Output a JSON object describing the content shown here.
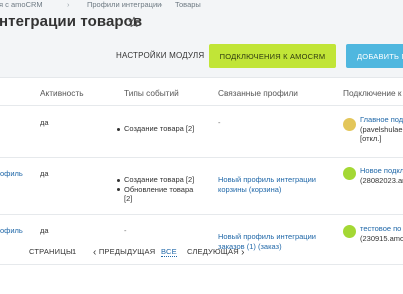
{
  "breadcrumb": {
    "items": [
      "я с amoCRM",
      "Профили интеграции",
      "Товары"
    ],
    "separator": "›"
  },
  "page": {
    "title": "нтеграции товаров",
    "favorite_icon": "star-outline-icon"
  },
  "toolbar": {
    "settings_label": "НАСТРОЙКИ МОДУЛЯ",
    "connections_label": "ПОДКЛЮЧЕНИЯ К AMOCRM",
    "add_label": "ДОБАВИТЬ ПР",
    "connections_color": "#c1e537",
    "add_color": "#4fb7df"
  },
  "table": {
    "headers": [
      "Активность",
      "Типы событий",
      "Связанные профили",
      "Подключение к"
    ],
    "rows": [
      {
        "name": "",
        "active": "да",
        "events": [
          "Создание товара [2]"
        ],
        "profiles": "-",
        "connection_status_color": "#e3c65a",
        "connection": [
          "Главное подк",
          "(pavelshulae",
          "[откл.]"
        ]
      },
      {
        "name": "офиль",
        "active": "да",
        "events": [
          "Создание товара [2]",
          "Обновление товара",
          "[2]"
        ],
        "profiles": [
          "Новый профиль интеграции",
          "корзины (корзина)"
        ],
        "connection_status_color": "#a4d834",
        "connection": [
          "Новое подкл",
          "(28082023.am"
        ]
      },
      {
        "name": "офиль",
        "active": "да",
        "events": "-",
        "profiles": [
          "Новый профиль интеграции",
          "заказов (1) (заказ)"
        ],
        "connection_status_color": "#a4d834",
        "connection": [
          "тестовое по",
          "(230915.amo"
        ]
      }
    ]
  },
  "pagination": {
    "pages_label": "СТРАНИЦЫ:",
    "current_page": "1",
    "prev_label": "ПРЕДЫДУЩАЯ",
    "all_label": "ВСЕ",
    "next_label": "СЛЕДУЮЩАЯ",
    "prev_icon": "chevron-left-icon",
    "next_icon": "chevron-right-icon"
  }
}
